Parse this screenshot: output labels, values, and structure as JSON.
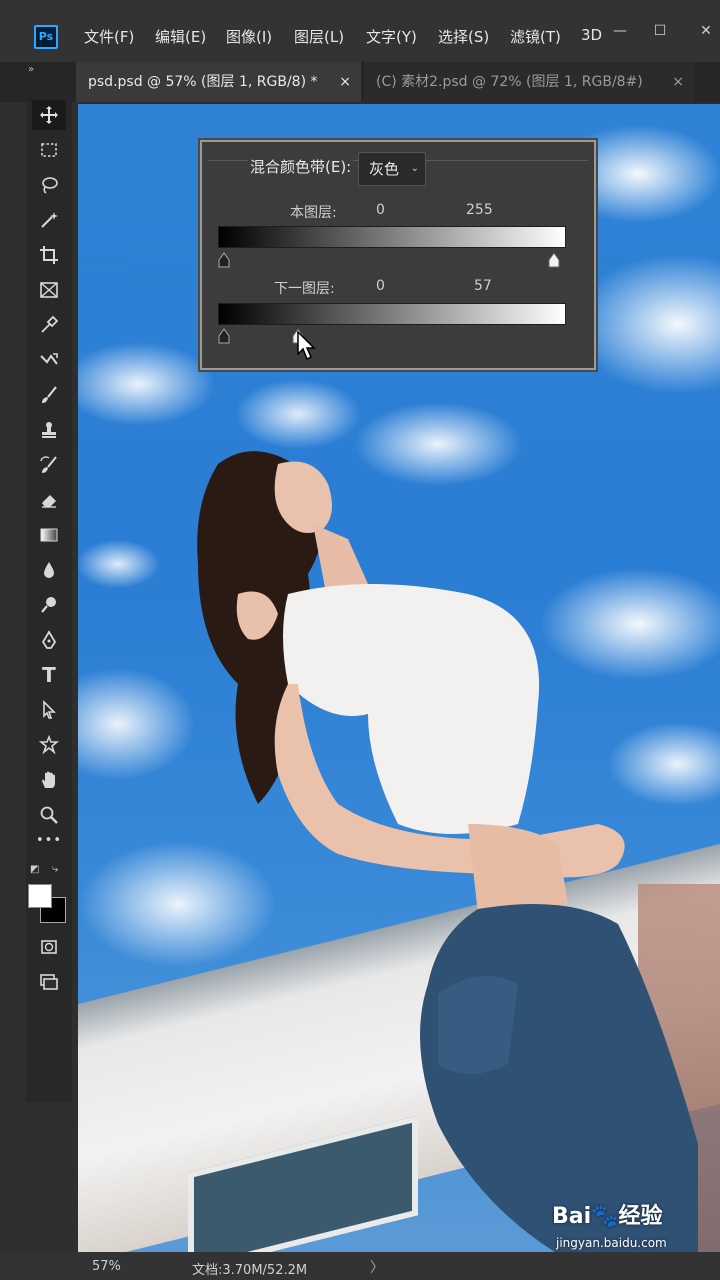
{
  "app": {
    "logo_text": "Ps"
  },
  "menu": {
    "items": [
      "文件(F)",
      "编辑(E)",
      "图像(I)",
      "图层(L)",
      "文字(Y)",
      "选择(S)",
      "滤镜(T)",
      "3D"
    ]
  },
  "window_controls": {
    "minimize": "—",
    "maximize": "☐",
    "close": "✕"
  },
  "tabs": [
    {
      "label": "psd.psd @ 57% (图层 1, RGB/8) *",
      "active": true
    },
    {
      "label": "(C) 素材2.psd @ 72% (图层 1, RGB/8#)",
      "active": false
    }
  ],
  "tab_close_symbol": "×",
  "tab_collapse": "»",
  "tools": [
    "move-tool",
    "marquee-tool",
    "lasso-tool",
    "magic-wand-tool",
    "crop-tool",
    "frame-tool",
    "eyedropper-tool",
    "healing-tool",
    "brush-tool",
    "clone-stamp-tool",
    "history-brush-tool",
    "eraser-tool",
    "gradient-tool",
    "blur-tool",
    "dodge-tool",
    "pen-tool",
    "type-tool",
    "path-selection-tool",
    "shape-tool",
    "hand-tool",
    "zoom-tool",
    "more-tools",
    "quick-mask",
    "screen-mode"
  ],
  "type_tool_glyph": "T",
  "more_tools_glyph": "•••",
  "colors": {
    "foreground": "#ffffff",
    "background": "#000000",
    "accent": "#31a8ff"
  },
  "blend_if": {
    "label": "混合颜色带(E):",
    "channel": "灰色",
    "this_layer": {
      "label": "本图层:",
      "min": "0",
      "max": "255",
      "black_point": 0,
      "white_point": 255
    },
    "underlying_layer": {
      "label": "下一图层:",
      "min": "0",
      "max": "57",
      "black_point": 0,
      "white_point": 57
    }
  },
  "status": {
    "zoom": "57%",
    "doc": "文档:3.70M/52.2M",
    "arrow": "〉"
  },
  "watermark": {
    "brand": "Bai🐾经验",
    "url": "jingyan.baidu.com"
  }
}
